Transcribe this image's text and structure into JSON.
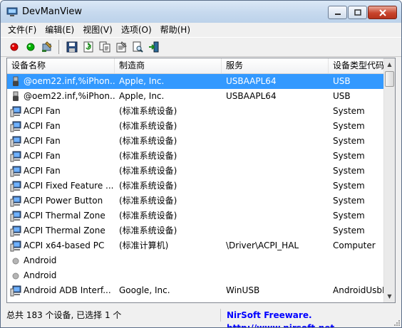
{
  "window": {
    "title": "DevManView"
  },
  "menu": [
    "文件(F)",
    "编辑(E)",
    "视图(V)",
    "选项(O)",
    "帮助(H)"
  ],
  "toolbar": [
    {
      "name": "red-record-icon",
      "color": "#e00000"
    },
    {
      "name": "green-record-icon",
      "color": "#00b000"
    },
    {
      "name": "wrench-properties-icon"
    },
    {
      "name": "save-icon"
    },
    {
      "name": "refresh-icon"
    },
    {
      "name": "copy-icon"
    },
    {
      "name": "properties-icon"
    },
    {
      "name": "find-icon"
    },
    {
      "name": "exit-icon"
    }
  ],
  "columns": [
    "设备名称",
    "制造商",
    "服务",
    "设备类型代码"
  ],
  "rows": [
    {
      "icon": "usb-plug-icon",
      "name": "@oem22.inf,%iPhon...",
      "manufacturer": "Apple, Inc.",
      "service": "USBAAPL64",
      "type": "USB",
      "selected": true
    },
    {
      "icon": "usb-plug-icon",
      "name": "@oem22.inf,%iPhon...",
      "manufacturer": "Apple, Inc.",
      "service": "USBAAPL64",
      "type": "USB",
      "selected": false
    },
    {
      "icon": "computer-icon",
      "name": "ACPI Fan",
      "manufacturer": "(标准系统设备)",
      "service": "",
      "type": "System",
      "selected": false
    },
    {
      "icon": "computer-icon",
      "name": "ACPI Fan",
      "manufacturer": "(标准系统设备)",
      "service": "",
      "type": "System",
      "selected": false
    },
    {
      "icon": "computer-icon",
      "name": "ACPI Fan",
      "manufacturer": "(标准系统设备)",
      "service": "",
      "type": "System",
      "selected": false
    },
    {
      "icon": "computer-icon",
      "name": "ACPI Fan",
      "manufacturer": "(标准系统设备)",
      "service": "",
      "type": "System",
      "selected": false
    },
    {
      "icon": "computer-icon",
      "name": "ACPI Fan",
      "manufacturer": "(标准系统设备)",
      "service": "",
      "type": "System",
      "selected": false
    },
    {
      "icon": "computer-icon",
      "name": "ACPI Fixed Feature ...",
      "manufacturer": "(标准系统设备)",
      "service": "",
      "type": "System",
      "selected": false
    },
    {
      "icon": "computer-icon",
      "name": "ACPI Power Button",
      "manufacturer": "(标准系统设备)",
      "service": "",
      "type": "System",
      "selected": false
    },
    {
      "icon": "computer-icon",
      "name": "ACPI Thermal Zone",
      "manufacturer": "(标准系统设备)",
      "service": "",
      "type": "System",
      "selected": false
    },
    {
      "icon": "computer-icon",
      "name": "ACPI Thermal Zone",
      "manufacturer": "(标准系统设备)",
      "service": "",
      "type": "System",
      "selected": false
    },
    {
      "icon": "computer-icon",
      "name": "ACPI x64-based PC",
      "manufacturer": "(标准计算机)",
      "service": "\\Driver\\ACPI_HAL",
      "type": "Computer",
      "selected": false
    },
    {
      "icon": "grey-dot-icon",
      "name": "Android",
      "manufacturer": "",
      "service": "",
      "type": "",
      "selected": false
    },
    {
      "icon": "grey-dot-icon",
      "name": "Android",
      "manufacturer": "",
      "service": "",
      "type": "",
      "selected": false
    },
    {
      "icon": "computer-icon",
      "name": "Android ADB Interf...",
      "manufacturer": "Google, Inc.",
      "service": "WinUSB",
      "type": "AndroidUsbD...",
      "selected": false
    }
  ],
  "status": {
    "left": "总共 183 个设备, 已选择 1 个",
    "right": "NirSoft Freeware.  http://www.nirsoft.net"
  },
  "colors": {
    "selection": "#3399ff",
    "link": "#0000ff"
  }
}
